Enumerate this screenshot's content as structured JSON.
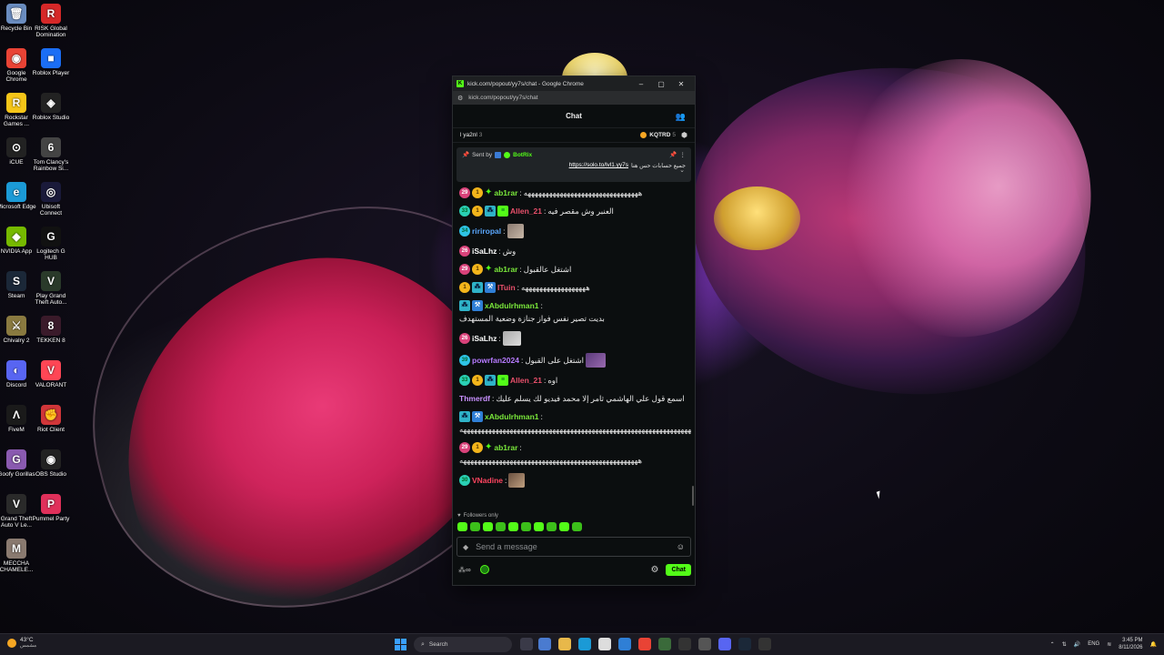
{
  "desktop": {
    "icons_col1": [
      {
        "label": "Recycle Bin",
        "glyph": "🗑",
        "color": "#6a8cbf"
      },
      {
        "label": "Google Chrome",
        "glyph": "◉",
        "color": "#e94335"
      },
      {
        "label": "Rockstar Games ...",
        "glyph": "R",
        "color": "#f5c518"
      },
      {
        "label": "iCUE",
        "glyph": "⊙",
        "color": "#222222"
      },
      {
        "label": "Microsoft Edge",
        "glyph": "e",
        "color": "#1b9ad6"
      },
      {
        "label": "NVIDIA App",
        "glyph": "◆",
        "color": "#76b900"
      },
      {
        "label": "Steam",
        "glyph": "S",
        "color": "#1b2838"
      },
      {
        "label": "Chivalry 2",
        "glyph": "⚔",
        "color": "#8a7a40"
      },
      {
        "label": "Discord",
        "glyph": "◐",
        "color": "#5865f2"
      },
      {
        "label": "FiveM",
        "glyph": "Λ",
        "color": "#1a1a1a"
      },
      {
        "label": "Goofy Gorillas",
        "glyph": "G",
        "color": "#8a5ab0"
      },
      {
        "label": "Grand Theft Auto V Le...",
        "glyph": "V",
        "color": "#2a2a2a"
      },
      {
        "label": "MECCHA CHAMELE...",
        "glyph": "M",
        "color": "#8a7a70"
      }
    ],
    "icons_col2": [
      {
        "label": "RISK Global Domination",
        "glyph": "R",
        "color": "#d62828"
      },
      {
        "label": "Roblox Player",
        "glyph": "■",
        "color": "#1b6ef5"
      },
      {
        "label": "Roblox Studio",
        "glyph": "◈",
        "color": "#222222"
      },
      {
        "label": "Tom Clancy's Rainbow Si...",
        "glyph": "6",
        "color": "#444444"
      },
      {
        "label": "Ubisoft Connect",
        "glyph": "◎",
        "color": "#1a1a3a"
      },
      {
        "label": "Logitech G HUB",
        "glyph": "G",
        "color": "#111111"
      },
      {
        "label": "Play Grand Theft Auto...",
        "glyph": "V",
        "color": "#2a3a2a"
      },
      {
        "label": "TEKKEN 8",
        "glyph": "8",
        "color": "#3a1a2a"
      },
      {
        "label": "VALORANT",
        "glyph": "V",
        "color": "#ff4655"
      },
      {
        "label": "Riot Client",
        "glyph": "✊",
        "color": "#d13639"
      },
      {
        "label": "OBS Studio",
        "glyph": "◉",
        "color": "#222222"
      },
      {
        "label": "Pummel Party",
        "glyph": "P",
        "color": "#e0305a"
      }
    ]
  },
  "window": {
    "title": "kick.com/popout/yy7s/chat - Google Chrome",
    "url": "kick.com/popout/yy7s/chat",
    "favicon": "K",
    "minimize": "–",
    "maximize": "▢",
    "close": "✕"
  },
  "chat": {
    "header": "Chat",
    "gifters": {
      "left_name": "l ya2nl",
      "left_count": "3",
      "right_name": "KQTRD",
      "right_count": "5"
    },
    "pinned": {
      "sent_by": "Sent by",
      "bot": "BotRix",
      "text_ar": "جميع حسابات حس هنا",
      "link": "https://solo.to/lvl1.yy7s"
    },
    "messages": [
      {
        "badges": [
          "29",
          "gift",
          "star"
        ],
        "user": "ab1rar",
        "ucls": "u-green",
        "text": "ههههههههههههههههههههههههههههههههه"
      },
      {
        "badges": [
          "33",
          "gift",
          "og",
          "vip"
        ],
        "user": "Allen_21",
        "ucls": "u-pink",
        "text": "العنبر وش مقصر فيه"
      },
      {
        "badges": [
          "34"
        ],
        "user": "ririropal",
        "ucls": "u-blue",
        "text": "",
        "emote": "e1"
      },
      {
        "badges": [
          "26"
        ],
        "user": "iSaLhz",
        "ucls": "u-white",
        "text": "وش"
      },
      {
        "badges": [
          "29",
          "gift",
          "star"
        ],
        "user": "ab1rar",
        "ucls": "u-green",
        "text": "اشتغل عالقبول"
      },
      {
        "badges": [
          "gift",
          "og",
          "mod"
        ],
        "user": "ITuin",
        "ucls": "u-pink",
        "text": "ههههههههههههههههههه"
      },
      {
        "badges": [
          "og",
          "mod"
        ],
        "user": "xAbdulrhman1",
        "ucls": "u-green",
        "text": "بديت تصير نفس فواز جنازة وضعية المستهدف"
      },
      {
        "badges": [
          "26"
        ],
        "user": "iSaLhz",
        "ucls": "u-white",
        "text": "",
        "emote": "e3"
      },
      {
        "badges": [
          "39"
        ],
        "user": "powrfan2024",
        "ucls": "u-purple",
        "text": "اشتغل على القبول",
        "emote": "e2"
      },
      {
        "badges": [
          "33",
          "gift",
          "og",
          "vip"
        ],
        "user": "Allen_21",
        "ucls": "u-pink",
        "text": "اوه"
      },
      {
        "badges": [],
        "user": "Thmerdf",
        "ucls": "u-violet",
        "text": "اسمع قول علي الهاشمي ثامر إلا محمد فيديو لك يسلم عليك"
      },
      {
        "badges": [
          "og",
          "mod"
        ],
        "user": "xAbdulrhman1",
        "ucls": "u-green",
        "text": "ههههههههههههههههههههههههههههههههههههههههههههههههههههههههههههههههههههههههههههههههه"
      },
      {
        "badges": [
          "29",
          "gift",
          "star"
        ],
        "user": "ab1rar",
        "ucls": "u-green",
        "text": "ههههههههههههههههههههههههههههههههههههههههههههههههههه"
      },
      {
        "badges": [
          "30"
        ],
        "user": "VNadine",
        "ucls": "u-red",
        "text": "",
        "emote": "e4"
      }
    ],
    "followers_only": "Followers only",
    "input_placeholder": "Send a message",
    "send_label": "Chat"
  },
  "taskbar": {
    "weather_temp": "43°C",
    "weather_desc": "مشمس",
    "search": "Search",
    "lang": "ENG",
    "time": "3:45 PM",
    "date": "8/11/2026"
  },
  "colors": {
    "kick_green": "#53fc18",
    "window_bg": "#0b0e0f"
  }
}
